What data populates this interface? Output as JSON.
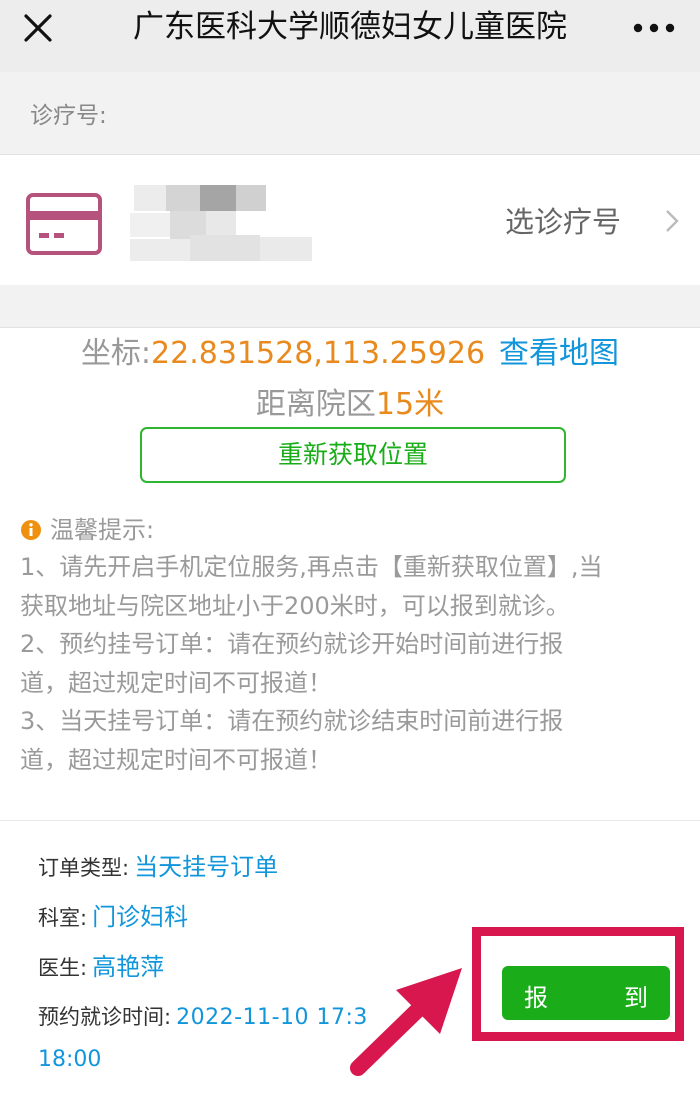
{
  "header": {
    "title": "广东医科大学顺德妇女儿童医院",
    "close_icon": "close-icon",
    "more_icon": "more-dots-icon"
  },
  "patient": {
    "section_label": "诊疗号:",
    "card_icon": "card-icon",
    "select_label": "选诊疗号",
    "chevron_icon": "chevron-right-icon"
  },
  "location": {
    "coords_label": "坐标:",
    "coords_value": "22.831528,113.25926",
    "map_link": "查看地图",
    "distance_prefix": "距离院区",
    "distance_value": "15米",
    "relocate_button": "重新获取位置"
  },
  "tips": {
    "info_icon": "info-icon",
    "title": "温馨提示:",
    "lines": [
      "1、请先开启手机定位服务,再点击【重新获取位置】,当",
      "获取地址与院区地址小于200米时，可以报到就诊。",
      "2、预约挂号订单：请在预约就诊开始时间前进行报",
      "道，超过规定时间不可报道！",
      "3、当天挂号订单：请在预约就诊结束时间前进行报",
      "道，超过规定时间不可报道！"
    ]
  },
  "order": {
    "type_label": "订单类型:",
    "type_value": "当天挂号订单",
    "dept_label": "科室:",
    "dept_value": "门诊妇科",
    "doctor_label": "医生:",
    "doctor_value": "高艳萍",
    "time_label": "预约就诊时间:",
    "time_value": "2022-11-10 17:3",
    "time_value_cont": "18:00"
  },
  "checkin": {
    "char1": "报",
    "char2": "到"
  },
  "colors": {
    "accent_green": "#1aad19",
    "link_blue": "#1296db",
    "value_orange": "#e88a1e",
    "annotation_red": "#d8174f"
  }
}
